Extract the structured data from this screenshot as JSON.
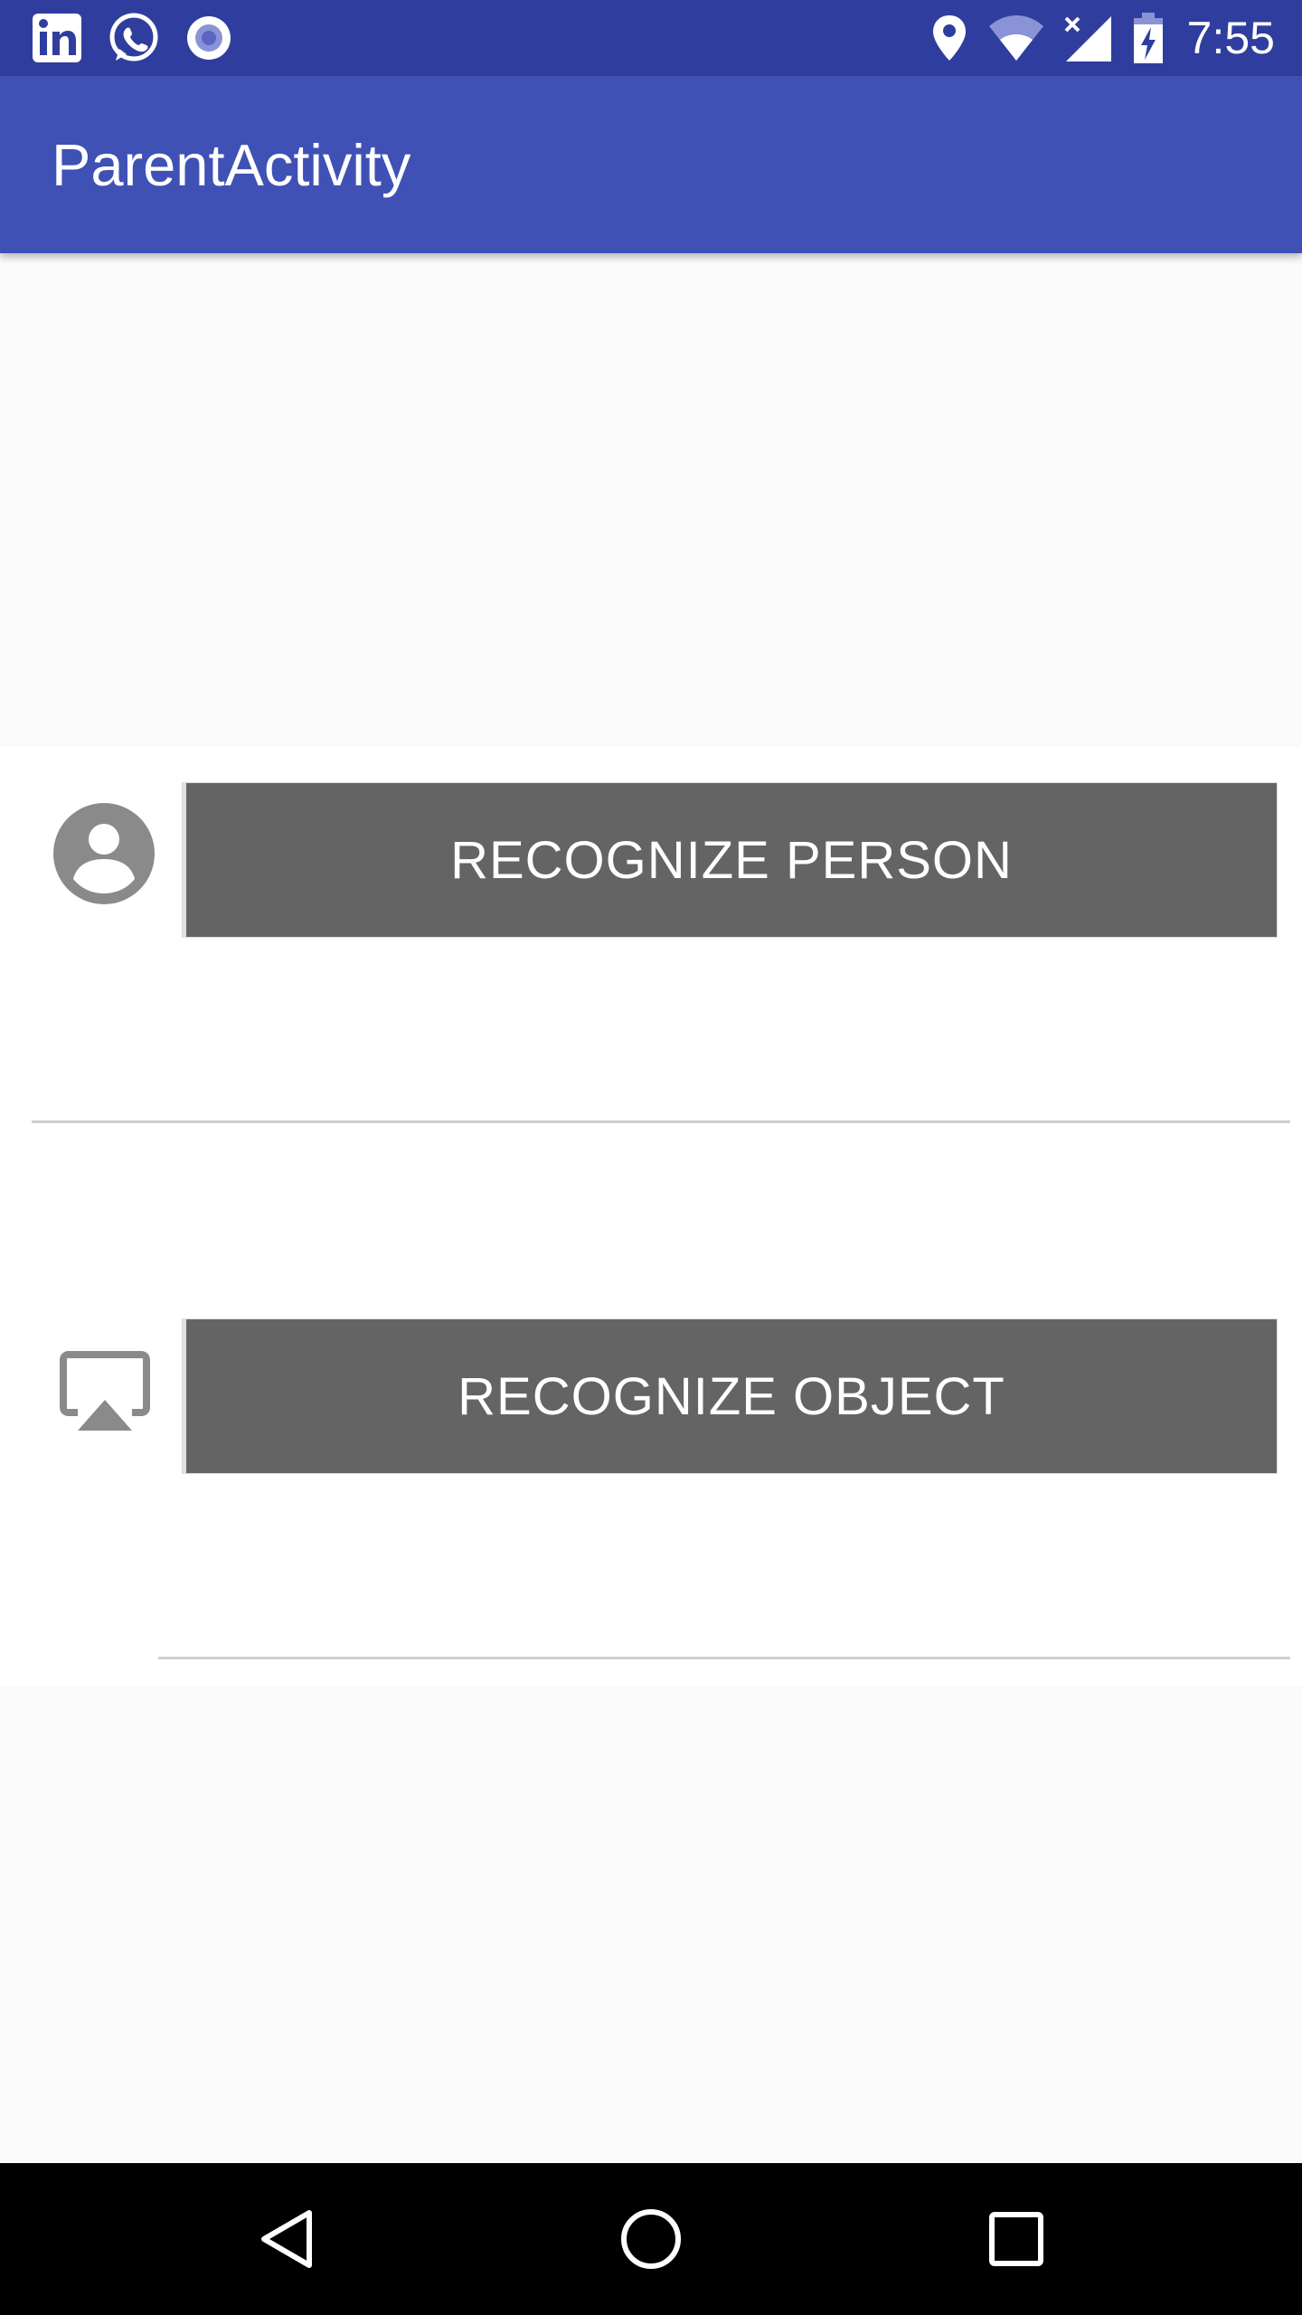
{
  "status_bar": {
    "time": "7:55",
    "left_icons": [
      "linkedin-icon",
      "whatsapp-icon",
      "radio-icon"
    ],
    "right_icons": [
      "location-icon",
      "wifi-icon",
      "signal-icon",
      "battery-charging-icon"
    ]
  },
  "app_bar": {
    "title": "ParentActivity",
    "color": "#3f51b5",
    "status_color": "#2f3e9e"
  },
  "actions": [
    {
      "icon": "person-icon",
      "label": "RECOGNIZE PERSON"
    },
    {
      "icon": "cast-icon",
      "label": "RECOGNIZE OBJECT"
    }
  ],
  "button_color": "#646464",
  "nav_bar": {
    "buttons": [
      "back-icon",
      "home-icon",
      "recents-icon"
    ]
  }
}
